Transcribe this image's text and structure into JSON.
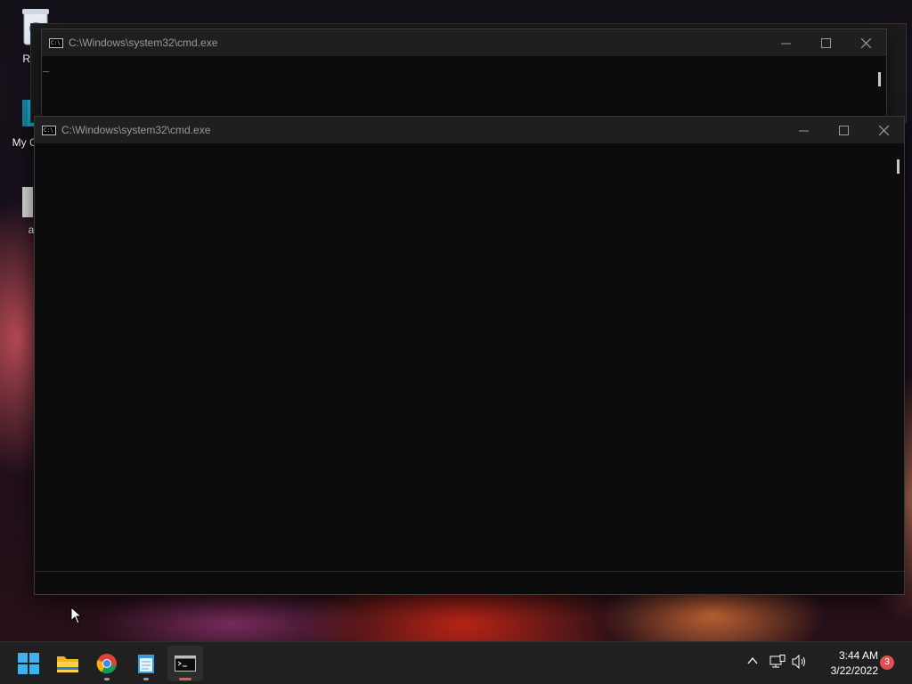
{
  "desktop": {
    "icons": [
      {
        "label": "Recy",
        "icon": "recycle-bin-icon"
      },
      {
        "label": "My Co",
        "icon": "computer-icon"
      },
      {
        "label": "a",
        "icon": "file-icon"
      }
    ]
  },
  "windows": [
    {
      "title": "C:\\Windows\\system32\\cmd.exe",
      "console_text": "_"
    },
    {
      "title": "C:\\Windows\\system32\\cmd.exe",
      "console_text": ""
    }
  ],
  "taskbar": {
    "apps": [
      {
        "name": "start",
        "icon": "windows-logo-icon"
      },
      {
        "name": "file-explorer",
        "icon": "folder-icon"
      },
      {
        "name": "chrome",
        "icon": "chrome-icon"
      },
      {
        "name": "notepad",
        "icon": "notepad-icon"
      },
      {
        "name": "command-prompt",
        "icon": "terminal-icon"
      }
    ],
    "clock": {
      "time": "3:44 AM",
      "date": "3/22/2022"
    },
    "notification_count": "3"
  },
  "colors": {
    "accent": "#e25a5a",
    "titlebar": "#1f1f1f",
    "console_bg": "#0c0c0c",
    "taskbar": "#202020"
  }
}
